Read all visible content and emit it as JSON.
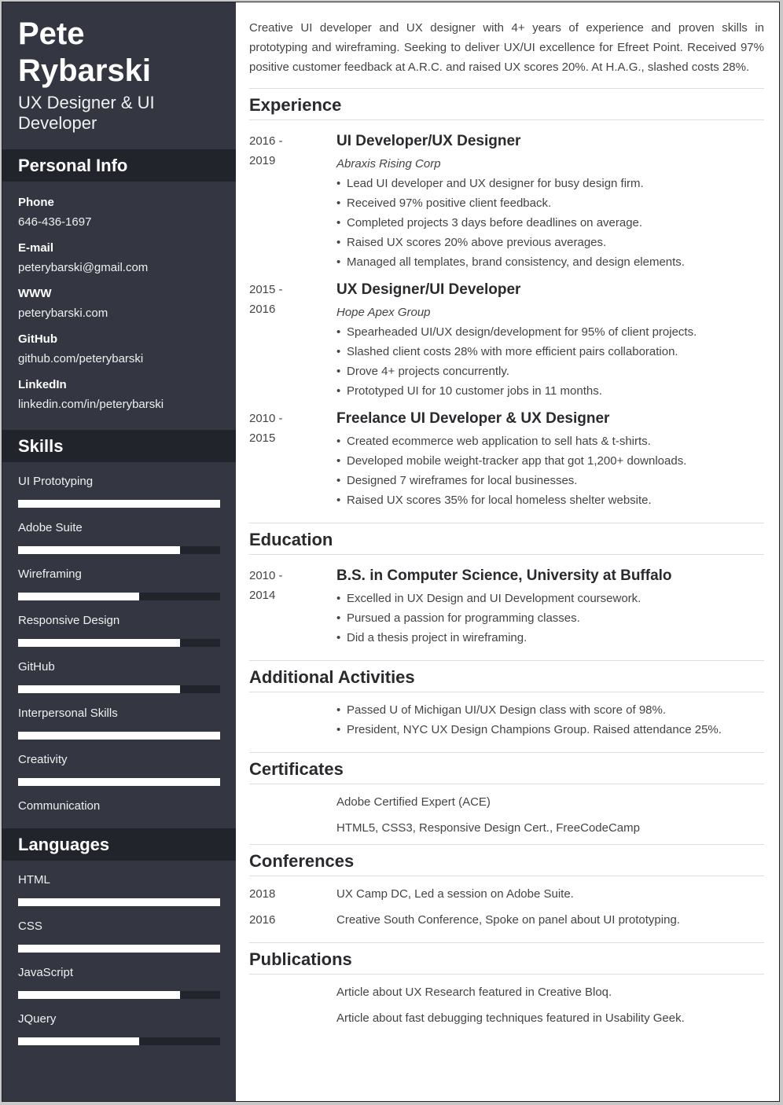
{
  "profile": {
    "first_name": "Pete",
    "last_name": "Rybarski",
    "title": "UX Designer & UI Developer"
  },
  "colors": {
    "sidebar_bg": "#343741",
    "sidebar_header_bg": "#22242c",
    "bar_fill": "#ffffff",
    "bar_track": "#22242c"
  },
  "personal_info": {
    "heading": "Personal Info",
    "items": [
      {
        "label": "Phone",
        "value": "646-436-1697"
      },
      {
        "label": "E-mail",
        "value": "peterybarski@gmail.com"
      },
      {
        "label": "WWW",
        "value": "peterybarski.com"
      },
      {
        "label": "GitHub",
        "value": "github.com/peterybarski"
      },
      {
        "label": "LinkedIn",
        "value": "linkedin.com/in/peterybarski"
      }
    ]
  },
  "skills": {
    "heading": "Skills",
    "items": [
      {
        "label": "UI Prototyping",
        "level": 1.0
      },
      {
        "label": "Adobe Suite",
        "level": 0.8
      },
      {
        "label": "Wireframing",
        "level": 0.6
      },
      {
        "label": "Responsive Design",
        "level": 0.8
      },
      {
        "label": "GitHub",
        "level": 0.8
      },
      {
        "label": "Interpersonal Skills",
        "level": 1.0
      },
      {
        "label": "Creativity",
        "level": 1.0
      },
      {
        "label": "Communication",
        "level": null
      }
    ]
  },
  "languages": {
    "heading": "Languages",
    "items": [
      {
        "label": "HTML",
        "level": 1.0
      },
      {
        "label": "CSS",
        "level": 1.0
      },
      {
        "label": "JavaScript",
        "level": 0.8
      },
      {
        "label": "JQuery",
        "level": 0.6
      }
    ]
  },
  "summary": "Creative UI developer and UX designer with 4+ years of experience and proven skills in prototyping and wireframing. Seeking to deliver UX/UI excellence for Efreet Point. Received 97% positive customer feedback at A.R.C. and raised UX scores 20%. At H.A.G., slashed costs 28%.",
  "experience": {
    "heading": "Experience",
    "entries": [
      {
        "date_start": "2016 -",
        "date_end": "2019",
        "role": "UI Developer/UX Designer",
        "company": "Abraxis Rising Corp",
        "bullets": [
          "Lead UI developer and UX designer for busy design firm.",
          "Received 97% positive client feedback.",
          "Completed projects 3 days before deadlines on average.",
          "Raised UX scores 20% above previous averages.",
          "Managed all templates, brand consistency, and design elements."
        ]
      },
      {
        "date_start": "2015 -",
        "date_end": "2016",
        "role": "UX Designer/UI Developer",
        "company": "Hope Apex Group",
        "bullets": [
          "Spearheaded UI/UX design/development for 95% of client projects.",
          "Slashed client costs 28% with more efficient pairs collaboration.",
          "Drove 4+ projects concurrently.",
          "Prototyped UI for 10 customer jobs in 11 months."
        ]
      },
      {
        "date_start": "2010 -",
        "date_end": "2015",
        "role": "Freelance UI Developer & UX Designer",
        "bullets": [
          "Created ecommerce web application to sell hats & t-shirts.",
          "Developed mobile weight-tracker app that got 1,200+ downloads.",
          "Designed 7 wireframes for local businesses.",
          "Raised UX scores 35% for local homeless shelter website."
        ]
      }
    ]
  },
  "education": {
    "heading": "Education",
    "entries": [
      {
        "date_start": "2010 -",
        "date_end": "2014",
        "degree": "B.S. in Computer Science, University at Buffalo",
        "bullets": [
          "Excelled in UX Design and UI Development coursework.",
          "Pursued a passion for programming classes.",
          "Did a thesis project in wireframing."
        ]
      }
    ]
  },
  "activities": {
    "heading": "Additional Activities",
    "bullets": [
      "Passed U of Michigan UI/UX Design class with score of 98%.",
      "President, NYC UX Design Champions Group. Raised attendance 25%."
    ]
  },
  "certificates": {
    "heading": "Certificates",
    "items": [
      "Adobe Certified Expert (ACE)",
      "HTML5, CSS3, Responsive Design Cert., FreeCodeCamp"
    ]
  },
  "conferences": {
    "heading": "Conferences",
    "items": [
      {
        "year": "2018",
        "text": "UX Camp DC, Led a session on Adobe Suite."
      },
      {
        "year": "2016",
        "text": "Creative South Conference, Spoke on panel about UI prototyping."
      }
    ]
  },
  "publications": {
    "heading": "Publications",
    "items": [
      "Article about UX Research featured in Creative Bloq.",
      "Article about fast debugging techniques featured in Usability Geek."
    ]
  }
}
